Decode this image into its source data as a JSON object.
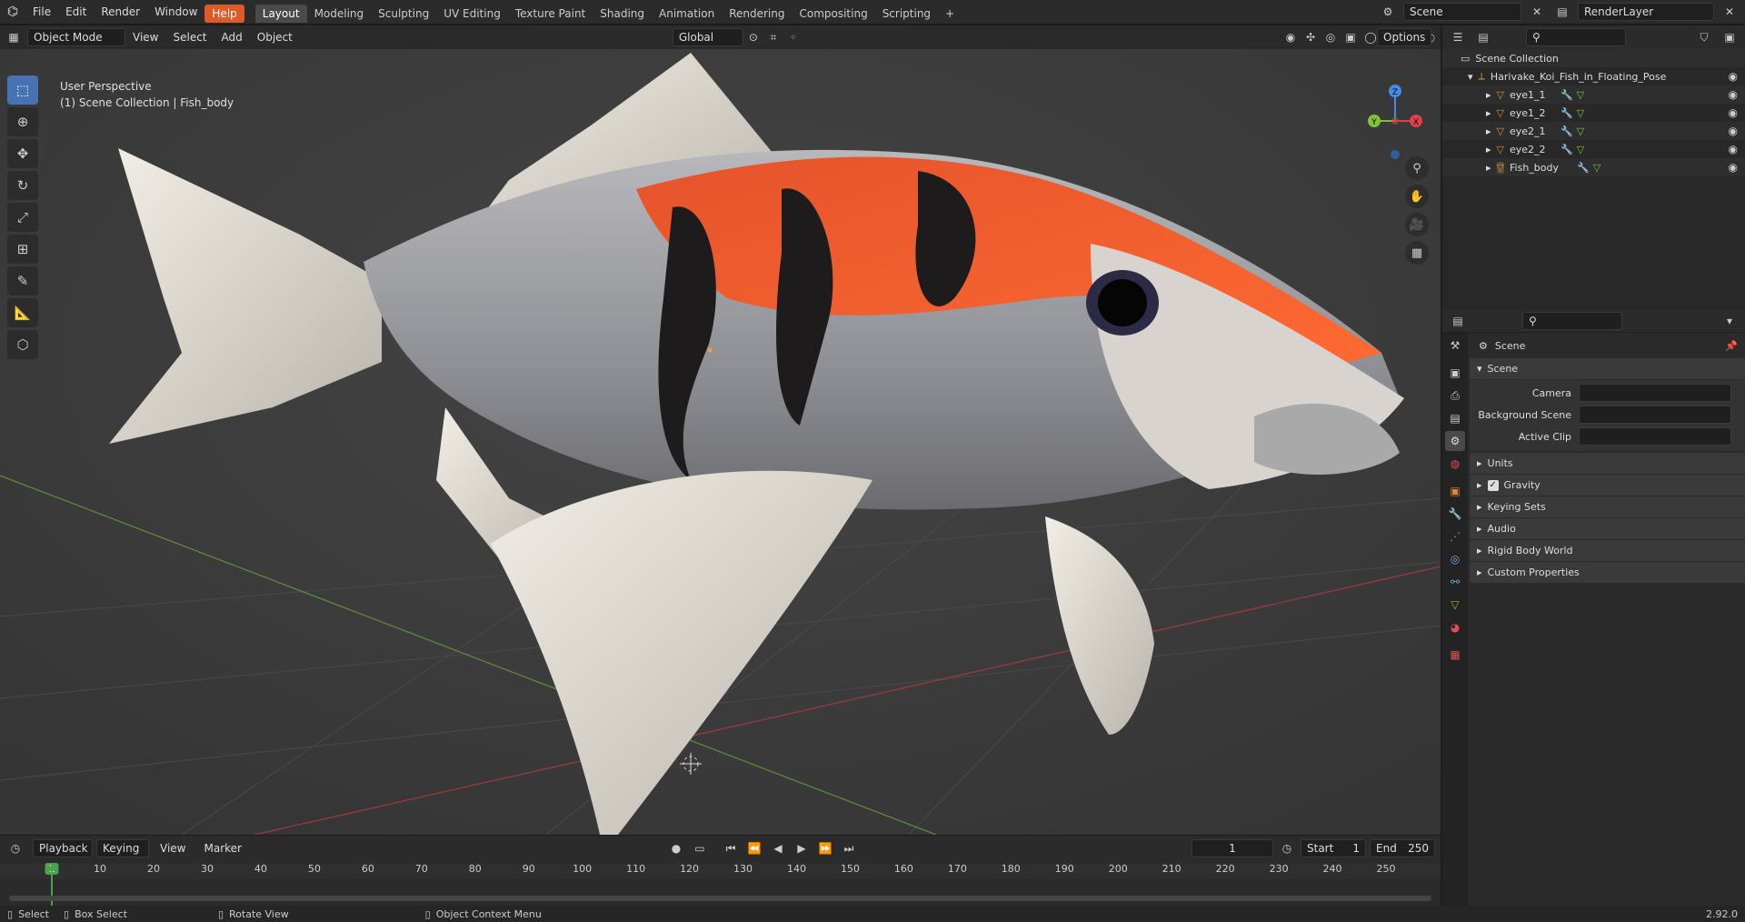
{
  "topbar": {
    "menus": [
      "File",
      "Edit",
      "Render",
      "Window",
      "Help"
    ],
    "active_menu": "Help",
    "workspaces": [
      "Layout",
      "Modeling",
      "Sculpting",
      "UV Editing",
      "Texture Paint",
      "Shading",
      "Animation",
      "Rendering",
      "Compositing",
      "Scripting"
    ],
    "active_workspace": "Layout",
    "add_tab": "+",
    "scene_name": "Scene",
    "view_layer": "RenderLayer"
  },
  "viewport_header": {
    "mode": "Object Mode",
    "menus": [
      "View",
      "Select",
      "Add",
      "Object"
    ],
    "orientation": "Global",
    "options": "Options"
  },
  "viewport": {
    "perspective": "User Perspective",
    "collection_info": "(1) Scene Collection | Fish_body",
    "gizmo_axes": {
      "z": "Z",
      "y": "Y",
      "x": "X"
    },
    "colors": {
      "x_axis": "#e0404a",
      "y_axis": "#7fc23a",
      "z_axis": "#3f8ee8"
    }
  },
  "outliner": {
    "root": "Scene Collection",
    "collection": "Harivake_Koi_Fish_in_Floating_Pose",
    "items": [
      "eye1_1",
      "eye1_2",
      "eye2_1",
      "eye2_2",
      "Fish_body"
    ]
  },
  "properties": {
    "context": "Scene",
    "panel_title": "Scene",
    "fields": [
      {
        "label": "Camera",
        "value": ""
      },
      {
        "label": "Background Scene",
        "value": ""
      },
      {
        "label": "Active Clip",
        "value": ""
      }
    ],
    "subpanels": [
      "Units",
      "Gravity",
      "Keying Sets",
      "Audio",
      "Rigid Body World",
      "Custom Properties"
    ],
    "gravity_checked": true
  },
  "timeline": {
    "menus": [
      "Playback",
      "Keying",
      "View",
      "Marker"
    ],
    "current_frame": "1",
    "start_label": "Start",
    "start": "1",
    "end_label": "End",
    "end": "250",
    "ticks": [
      "1",
      "10",
      "20",
      "30",
      "40",
      "50",
      "60",
      "70",
      "80",
      "90",
      "100",
      "110",
      "120",
      "130",
      "140",
      "150",
      "160",
      "170",
      "180",
      "190",
      "200",
      "210",
      "220",
      "230",
      "240",
      "250"
    ]
  },
  "statusbar": {
    "select": "Select",
    "box_select": "Box Select",
    "rotate_view": "Rotate View",
    "context_menu": "Object Context Menu",
    "version": "2.92.0"
  }
}
